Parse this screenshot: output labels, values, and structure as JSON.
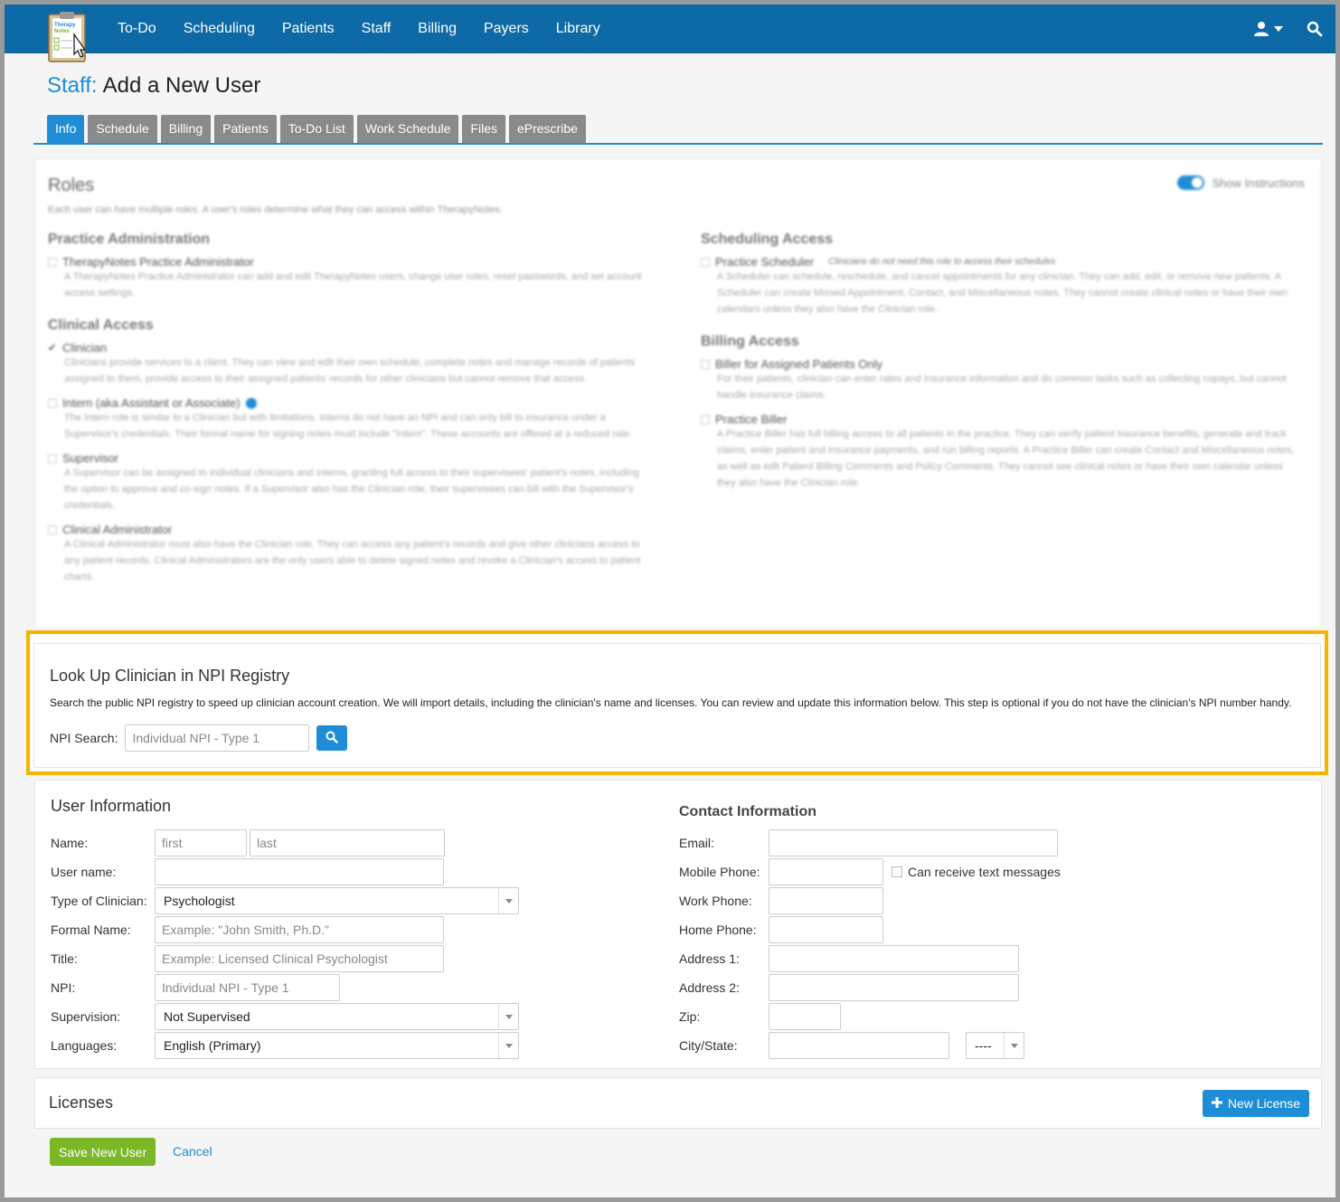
{
  "nav": {
    "logo_text": "Therapy Notes",
    "items": [
      "To-Do",
      "Scheduling",
      "Patients",
      "Staff",
      "Billing",
      "Payers",
      "Library"
    ]
  },
  "page": {
    "crumb": "Staff:",
    "title": "Add a New User"
  },
  "tabs": [
    "Info",
    "Schedule",
    "Billing",
    "Patients",
    "To-Do List",
    "Work Schedule",
    "Files",
    "ePrescribe"
  ],
  "roles": {
    "title": "Roles",
    "subtitle": "Each user can have multiple roles. A user's roles determine what they can access within TherapyNotes.",
    "show_instructions": "Show Instructions",
    "practice_admin": {
      "heading": "Practice Administration",
      "role": "TherapyNotes Practice Administrator",
      "desc": "A TherapyNotes Practice Administrator can add and edit TherapyNotes users, change user roles, reset passwords, and set account access settings."
    },
    "clinical": {
      "heading": "Clinical Access",
      "roles": [
        {
          "name": "Clinician",
          "desc": "Clinicians provide services to a client. They can view and edit their own schedule, complete notes and manage records of patients assigned to them, provide access to their assigned patients' records for other clinicians but cannot remove that access."
        },
        {
          "name": "Intern (aka Assistant or Associate)",
          "desc": "The Intern role is similar to a Clinician but with limitations. Interns do not have an NPI and can only bill to insurance under a Supervisor's credentials. Their formal name for signing notes must include \"Intern\". These accounts are offered at a reduced rate."
        },
        {
          "name": "Supervisor",
          "desc": "A Supervisor can be assigned to individual clinicians and interns, granting full access to their supervisees' patient's notes, including the option to approve and co-sign notes. If a Supervisor also has the Clinician role, their supervisees can bill with the Supervisor's credentials."
        },
        {
          "name": "Clinical Administrator",
          "desc": "A Clinical Administrator must also have the Clinician role. They can access any patient's records and give other clinicians access to any patient records. Clinical Administrators are the only users able to delete signed notes and revoke a Clinician's access to patient charts."
        }
      ]
    },
    "scheduling": {
      "heading": "Scheduling Access",
      "role": "Practice Scheduler",
      "note": "Clinicians do not need this role to access their schedules",
      "desc": "A Scheduler can schedule, reschedule, and cancel appointments for any clinician. They can add, edit, or remove new patients. A Scheduler can create Missed Appointment, Contact, and Miscellaneous notes. They cannot create clinical notes or have their own calendars unless they also have the Clinician role."
    },
    "billing": {
      "heading": "Billing Access",
      "roles": [
        {
          "name": "Biller for Assigned Patients Only",
          "desc": "For their patients, clinician can enter rates and insurance information and do common tasks such as collecting copays, but cannot handle insurance claims."
        },
        {
          "name": "Practice Biller",
          "desc": "A Practice Biller has full billing access to all patients in the practice. They can verify patient insurance benefits, generate and track claims, enter patient and insurance payments, and run billing reports. A Practice Biller can create Contact and Miscellaneous notes, as well as edit Patient Billing Comments and Policy Comments. They cannot see clinical notes or have their own calendar unless they also have the Clinician role."
        }
      ]
    }
  },
  "npi": {
    "title": "Look Up Clinician in NPI Registry",
    "desc": "Search the public NPI registry to speed up clinician account creation. We will import details, including the clinician's name and licenses. You can review and update this information below. This step  is optional if you do not have the clinician's NPI number handy.",
    "label": "NPI Search:",
    "placeholder": "Individual NPI - Type 1"
  },
  "user_info": {
    "title": "User Information",
    "name_label": "Name:",
    "first_placeholder": "first",
    "last_placeholder": "last",
    "username_label": "User name:",
    "type_label": "Type of Clinician:",
    "type_value": "Psychologist",
    "formal_label": "Formal Name:",
    "formal_placeholder": "Example: \"John Smith, Ph.D.\"",
    "title_label": "Title:",
    "title_placeholder": "Example: Licensed Clinical Psychologist",
    "npi_label": "NPI:",
    "npi_placeholder": "Individual NPI - Type 1",
    "supervision_label": "Supervision:",
    "supervision_value": "Not Supervised",
    "languages_label": "Languages:",
    "languages_value": "English (Primary)"
  },
  "contact_info": {
    "title": "Contact Information",
    "email_label": "Email:",
    "mobile_label": "Mobile Phone:",
    "text_label": "Can receive text messages",
    "work_label": "Work Phone:",
    "home_label": "Home Phone:",
    "addr1_label": "Address 1:",
    "addr2_label": "Address 2:",
    "zip_label": "Zip:",
    "city_label": "City/State:",
    "state_value": "----"
  },
  "licenses": {
    "title": "Licenses",
    "new_label": "New License"
  },
  "actions": {
    "save": "Save New User",
    "cancel": "Cancel"
  },
  "colors": {
    "nav": "#0d6aa6",
    "accent": "#1f8dd6",
    "save": "#7ab827",
    "highlight": "#f4b400"
  }
}
